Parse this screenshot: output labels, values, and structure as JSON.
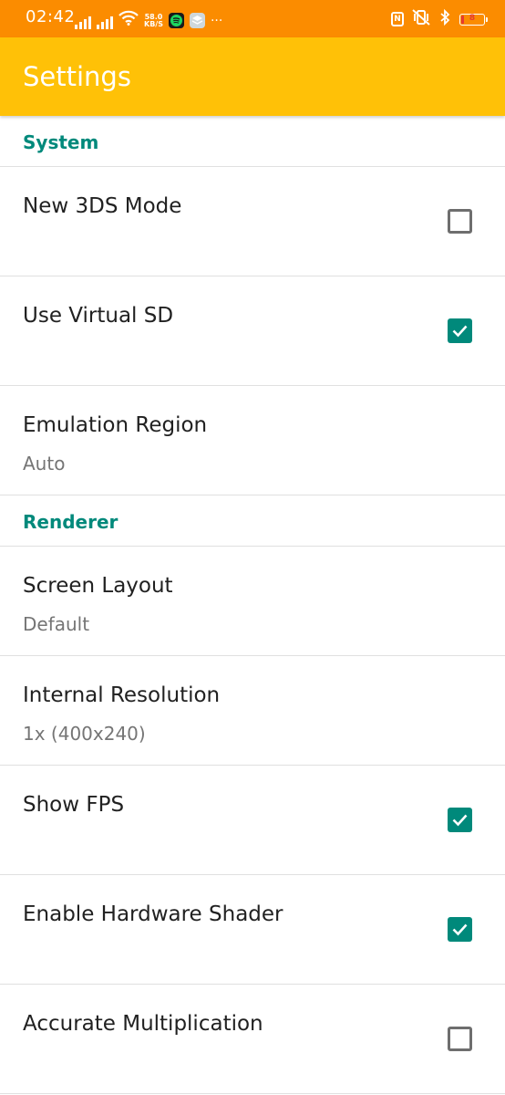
{
  "status_bar": {
    "time": "02:42",
    "net_speed_value": "58.0",
    "net_speed_unit": "KB/S",
    "overflow": "···",
    "battery_level": "8",
    "icons": [
      "signal-icon",
      "signal-icon",
      "wifi-icon",
      "spotify-icon",
      "stack-app-icon",
      "nfc-icon",
      "vibrate-icon",
      "bluetooth-icon",
      "battery-icon"
    ]
  },
  "app_bar": {
    "title": "Settings"
  },
  "colors": {
    "status_bar": "#fb8c00",
    "app_bar": "#ffc107",
    "accent": "#00897b",
    "battery_low": "#e53935"
  },
  "sections": [
    {
      "header": "System",
      "items": [
        {
          "title": "New 3DS Mode",
          "summary": "",
          "checked": false
        },
        {
          "title": "Use Virtual SD",
          "summary": "",
          "checked": true
        },
        {
          "title": "Emulation Region",
          "summary": "Auto"
        }
      ]
    },
    {
      "header": "Renderer",
      "items": [
        {
          "title": "Screen Layout",
          "summary": "Default"
        },
        {
          "title": "Internal Resolution",
          "summary": "1x (400x240)"
        },
        {
          "title": "Show FPS",
          "summary": "",
          "checked": true
        },
        {
          "title": "Enable Hardware Shader",
          "summary": "",
          "checked": true
        },
        {
          "title": "Accurate Multiplication",
          "summary": "",
          "checked": false
        }
      ]
    }
  ]
}
